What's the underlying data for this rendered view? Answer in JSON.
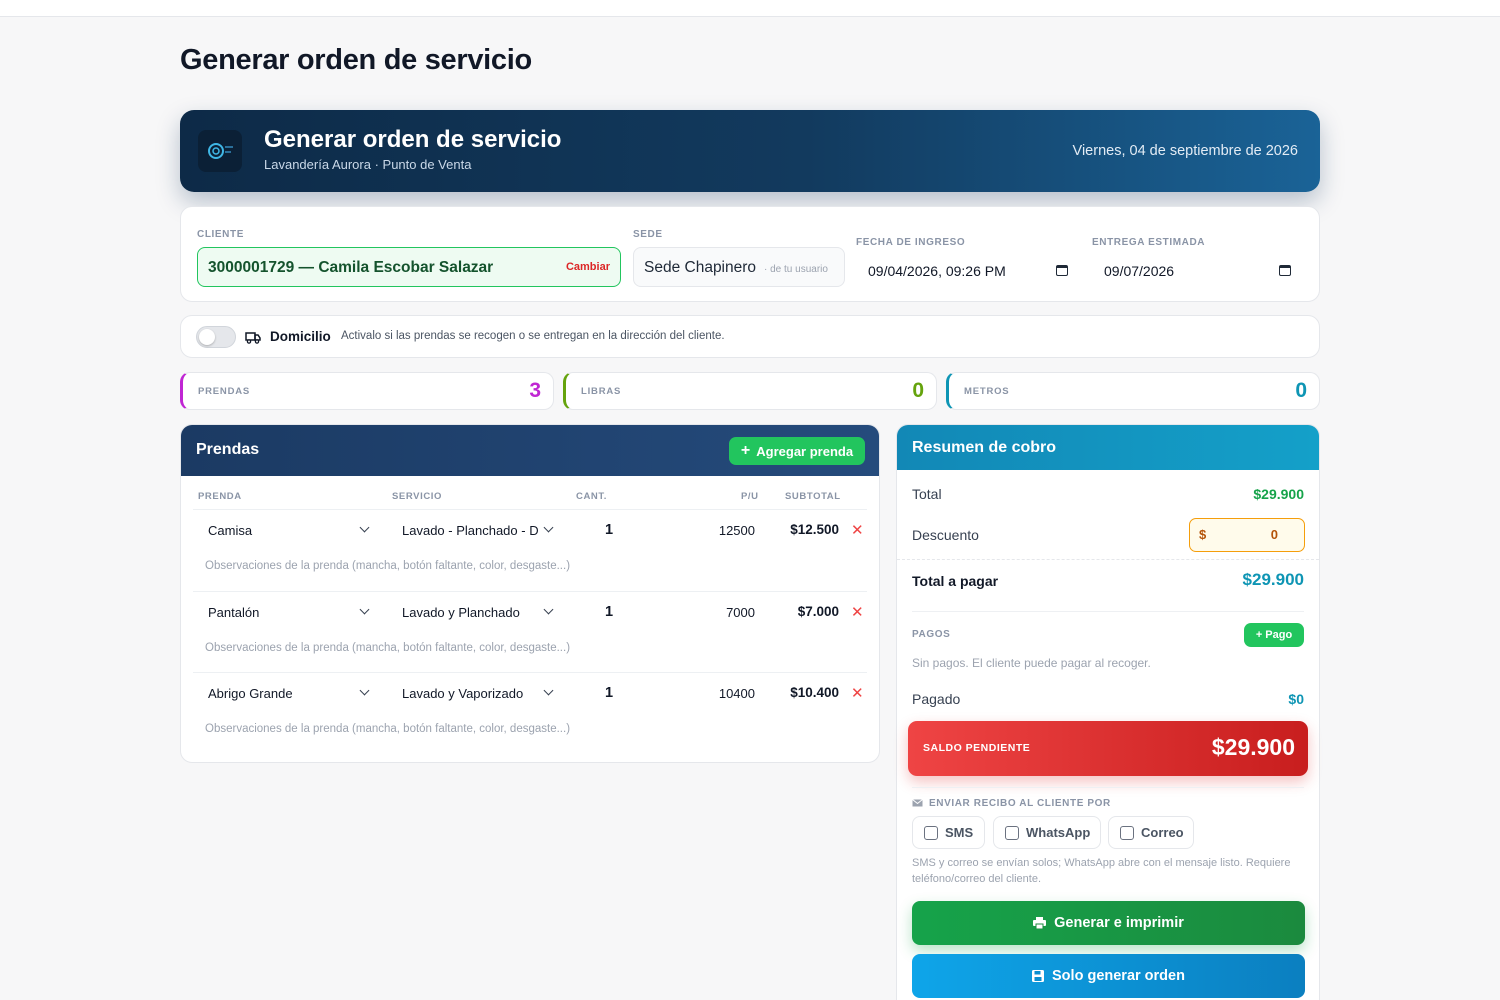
{
  "page": {
    "title": "Generar orden de servicio"
  },
  "header": {
    "title": "Generar orden de servicio",
    "subtitle": "Lavandería Aurora · Punto de Venta",
    "date": "Viernes, 04 de septiembre de 2026"
  },
  "form": {
    "client_label": "CLIENTE",
    "client_value": "3000001729 — Camila Escobar Salazar",
    "client_change": "Cambiar",
    "sede_label": "SEDE",
    "sede_value": "Sede Chapinero",
    "sede_hint": "· de tu usuario",
    "ingreso_label": "FECHA DE INGRESO",
    "ingreso_value": "09/04/2026, 09:26 PM",
    "entrega_label": "ENTREGA ESTIMADA",
    "entrega_value": "09/07/2026"
  },
  "delivery": {
    "label": "Domicilio",
    "hint": "Activalo si las prendas se recogen o se entregan en la dirección del cliente.",
    "enabled": false
  },
  "stats": [
    {
      "label": "PRENDAS",
      "value": "3",
      "color": "#c026d3"
    },
    {
      "label": "LIBRAS",
      "value": "0",
      "color": "#65a30d"
    },
    {
      "label": "METROS",
      "value": "0",
      "color": "#0e95b4"
    }
  ],
  "prendas": {
    "title": "Prendas",
    "add_label": "Agregar prenda",
    "columns": [
      "PRENDA",
      "SERVICIO",
      "CANT.",
      "P/U",
      "SUBTOTAL"
    ],
    "obs_placeholder": "Observaciones de la prenda (mancha, botón faltante, color, desgaste...)",
    "rows": [
      {
        "prenda": "Camisa",
        "servicio": "Lavado - Planchado - D",
        "cant": "1",
        "pu": "12500",
        "subtotal": "$12.500"
      },
      {
        "prenda": "Pantalón",
        "servicio": "Lavado y Planchado",
        "cant": "1",
        "pu": "7000",
        "subtotal": "$7.000"
      },
      {
        "prenda": "Abrigo Grande",
        "servicio": "Lavado y Vaporizado",
        "cant": "1",
        "pu": "10400",
        "subtotal": "$10.400"
      }
    ]
  },
  "summary": {
    "title": "Resumen de cobro",
    "total_label": "Total",
    "total_value": "$29.900",
    "discount_label": "Descuento",
    "discount_symbol": "$",
    "discount_value": "0",
    "to_pay_label": "Total a pagar",
    "to_pay_value": "$29.900",
    "payments_label": "PAGOS",
    "add_payment": "+ Pago",
    "no_payments": "Sin pagos. El cliente puede pagar al recoger.",
    "paid_label": "Pagado",
    "paid_value": "$0",
    "balance_label": "SALDO PENDIENTE",
    "balance_value": "$29.900",
    "receipt_label": "ENVIAR RECIBO AL CLIENTE POR",
    "channels": [
      "SMS",
      "WhatsApp",
      "Correo"
    ],
    "receipt_hint": "SMS y correo se envían solos; WhatsApp abre con el mensaje listo. Requiere teléfono/correo del cliente.",
    "primary_button": "Generar e imprimir",
    "secondary_button": "Solo generar orden"
  },
  "colors": {
    "accent_green": "#22c55e",
    "total_green": "#16a34a",
    "to_pay_teal": "#0e95b4",
    "danger": "#ef4444"
  }
}
